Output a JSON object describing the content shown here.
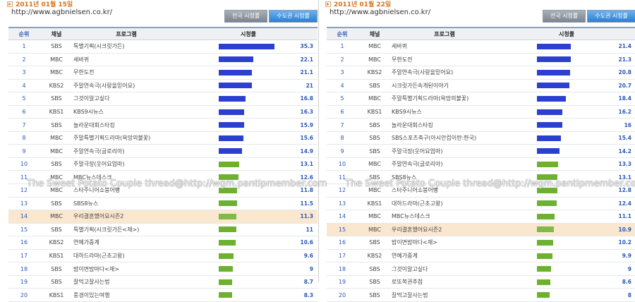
{
  "headers": {
    "rank": "순위",
    "channel": "채널",
    "program": "프로그램",
    "rating": "시청률"
  },
  "tabs": [
    "전국 시청률",
    "수도권 시청률"
  ],
  "scale_max": 35.3,
  "watermark": "The Sweet Potato Couple thread@http://wgm.pantipmember.com",
  "colors": {
    "blue_bar": "#2b3fd0",
    "green_bar": "#6db12f",
    "highlight_row": "#f9e7cf",
    "date": "#d4731a",
    "rank_text": "#2a58b8"
  },
  "panels": [
    {
      "date": "2011년 01월 15일",
      "url": "http://www.agbnielsen.co.kr/",
      "active_tab": 1,
      "rows": [
        {
          "rank": "1",
          "channel": "SBS",
          "program": "특별기획(시크릿가든)",
          "rating": "35.3",
          "color": "blue"
        },
        {
          "rank": "2",
          "channel": "MBC",
          "program": "세바퀴",
          "rating": "22.1",
          "color": "blue"
        },
        {
          "rank": "3",
          "channel": "MBC",
          "program": "무한도전",
          "rating": "21.1",
          "color": "blue"
        },
        {
          "rank": "4",
          "channel": "KBS2",
          "program": "주말연속극(사랑을믿어요)",
          "rating": "21",
          "color": "blue"
        },
        {
          "rank": "5",
          "channel": "SBS",
          "program": "그것이알고싶다",
          "rating": "16.8",
          "color": "blue"
        },
        {
          "rank": "6",
          "channel": "KBS1",
          "program": "KBS9시뉴스",
          "rating": "16.3",
          "color": "blue"
        },
        {
          "rank": "7",
          "channel": "SBS",
          "program": "놀라운대회스타킹",
          "rating": "15.9",
          "color": "blue"
        },
        {
          "rank": "8",
          "channel": "MBC",
          "program": "주말특별기획드라마(욕망의불꽃)",
          "rating": "15.6",
          "color": "blue"
        },
        {
          "rank": "9",
          "channel": "MBC",
          "program": "주말연속극(글로리아)",
          "rating": "14.9",
          "color": "blue"
        },
        {
          "rank": "10",
          "channel": "SBS",
          "program": "주말극장(웃어요엄마)",
          "rating": "13.1",
          "color": "green"
        },
        {
          "rank": "11",
          "channel": "MBC",
          "program": "MBC뉴스데스크",
          "rating": "12.6",
          "color": "green"
        },
        {
          "rank": "12",
          "channel": "MBC",
          "program": "스타주니어쇼붕어빵",
          "rating": "11.8",
          "color": "green"
        },
        {
          "rank": "13",
          "channel": "SBS",
          "program": "SBS8뉴스",
          "rating": "11.5",
          "color": "green"
        },
        {
          "rank": "14",
          "channel": "MBC",
          "program": "우리결혼했어요시즌2",
          "rating": "11.3",
          "color": "green",
          "highlight": true
        },
        {
          "rank": "15",
          "channel": "SBS",
          "program": "특별기획(시크릿가든<재>)",
          "rating": "11",
          "color": "green"
        },
        {
          "rank": "16",
          "channel": "KBS2",
          "program": "연예가중계",
          "rating": "10.6",
          "color": "green"
        },
        {
          "rank": "17",
          "channel": "KBS1",
          "program": "대하드라마(근초고왕)",
          "rating": "9.6",
          "color": "green"
        },
        {
          "rank": "18",
          "channel": "SBS",
          "program": "밤이면밤마다<재>",
          "rating": "9",
          "color": "green"
        },
        {
          "rank": "19",
          "channel": "SBS",
          "program": "잘먹고잘사는법",
          "rating": "8.7",
          "color": "green"
        },
        {
          "rank": "20",
          "channel": "KBS1",
          "program": "풍경이있는여행",
          "rating": "8.3",
          "color": "green"
        }
      ]
    },
    {
      "date": "2011년 01월 22일",
      "url": "http://www.agbnielsen.co.kr/",
      "active_tab": 1,
      "rows": [
        {
          "rank": "1",
          "channel": "MBC",
          "program": "세바퀴",
          "rating": "21.4",
          "color": "blue"
        },
        {
          "rank": "2",
          "channel": "MBC",
          "program": "무한도전",
          "rating": "21.3",
          "color": "blue"
        },
        {
          "rank": "3",
          "channel": "KBS2",
          "program": "주말연속극(사랑을믿어요)",
          "rating": "20.8",
          "color": "blue"
        },
        {
          "rank": "4",
          "channel": "SBS",
          "program": "시크릿가든속개된이야기",
          "rating": "20.7",
          "color": "blue"
        },
        {
          "rank": "5",
          "channel": "MBC",
          "program": "주말특별기획드라마(욕망의불꽃)",
          "rating": "18.4",
          "color": "blue"
        },
        {
          "rank": "6",
          "channel": "KBS1",
          "program": "KBS9시뉴스",
          "rating": "16.2",
          "color": "blue"
        },
        {
          "rank": "7",
          "channel": "SBS",
          "program": "놀라운대회스타킹",
          "rating": "16",
          "color": "blue"
        },
        {
          "rank": "8",
          "channel": "SBS",
          "program": "SBS스포츠축구(아시안컵이란:한국)",
          "rating": "15.4",
          "color": "blue"
        },
        {
          "rank": "9",
          "channel": "SBS",
          "program": "주말극장(웃어요엄마)",
          "rating": "14.2",
          "color": "blue"
        },
        {
          "rank": "10",
          "channel": "MBC",
          "program": "주말연속극(글로리아)",
          "rating": "13.3",
          "color": "green"
        },
        {
          "rank": "11",
          "channel": "SBS",
          "program": "SBS8뉴스",
          "rating": "13.1",
          "color": "green"
        },
        {
          "rank": "12",
          "channel": "MBC",
          "program": "스타주니어쇼붕어빵",
          "rating": "12.8",
          "color": "green"
        },
        {
          "rank": "13",
          "channel": "KBS1",
          "program": "대하드라마(근초고왕)",
          "rating": "12.4",
          "color": "green"
        },
        {
          "rank": "14",
          "channel": "MBC",
          "program": "MBC뉴스데스크",
          "rating": "11.1",
          "color": "green"
        },
        {
          "rank": "15",
          "channel": "MBC",
          "program": "우리결혼했어요시즌2",
          "rating": "10.9",
          "color": "green",
          "highlight": true
        },
        {
          "rank": "16",
          "channel": "SBS",
          "program": "밤이면밤마다<재>",
          "rating": "10.2",
          "color": "green"
        },
        {
          "rank": "17",
          "channel": "KBS2",
          "program": "연예가중계",
          "rating": "9.9",
          "color": "green"
        },
        {
          "rank": "18",
          "channel": "SBS",
          "program": "그것이알고싶다",
          "rating": "9",
          "color": "green"
        },
        {
          "rank": "19",
          "channel": "SBS",
          "program": "로또복권추첨",
          "rating": "8.6",
          "color": "green"
        },
        {
          "rank": "20",
          "channel": "SBS",
          "program": "잘먹고잘사는법",
          "rating": "8",
          "color": "green"
        }
      ]
    }
  ]
}
